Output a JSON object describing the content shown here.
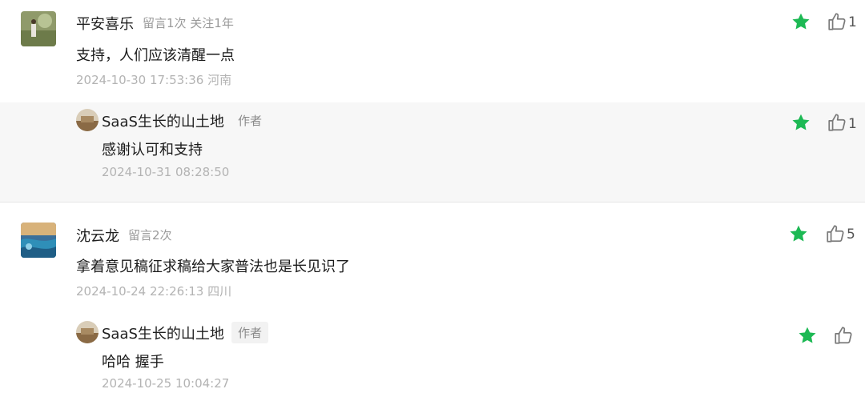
{
  "comments": [
    {
      "author": "平安喜乐",
      "meta": "留言1次 关注1年",
      "content": "支持，人们应该清醒一点",
      "time": "2024-10-30 17:53:36 河南",
      "likes": "1",
      "reply": {
        "author": "SaaS生长的山土地",
        "tag": "作者",
        "content": "感谢认可和支持",
        "time": "2024-10-31 08:28:50",
        "likes": "1"
      }
    },
    {
      "author": "沈云龙",
      "meta": "留言2次",
      "content": "拿着意见稿征求稿给大家普法也是长见识了",
      "time": "2024-10-24 22:26:13 四川",
      "likes": "5",
      "reply": {
        "author": "SaaS生长的山土地",
        "tag": "作者",
        "content": "哈哈 握手",
        "time": "2024-10-25 10:04:27",
        "likes": ""
      }
    }
  ],
  "colors": {
    "star": "#1db954",
    "icon": "#7a7a7a",
    "reply_bg": "#f7f7f7"
  },
  "icons": {
    "star": "star-icon",
    "like": "thumbs-up-icon"
  }
}
